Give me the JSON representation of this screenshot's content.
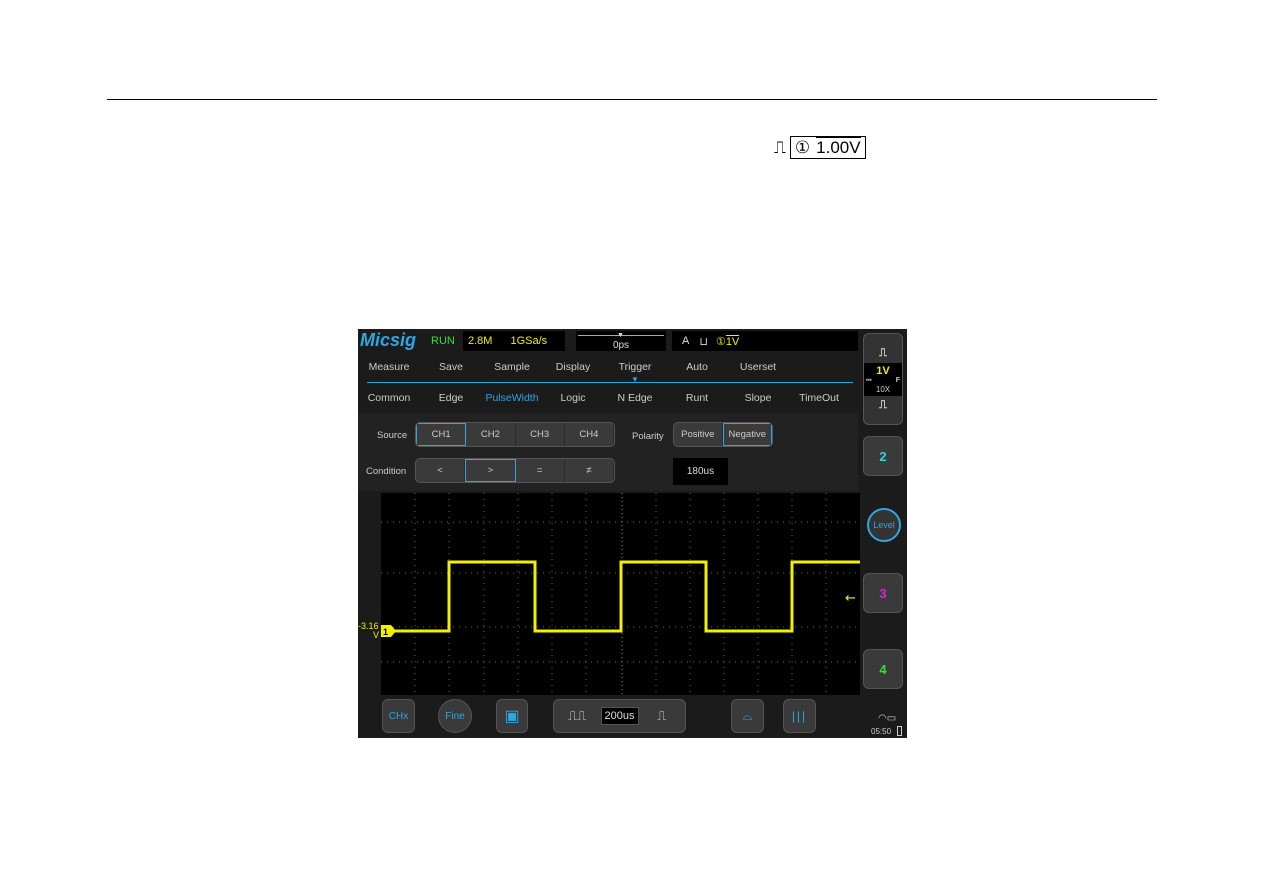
{
  "doc": {
    "trigger_symbol": "pulse-icon",
    "source": "①",
    "level": "1.00V"
  },
  "header": {
    "brand": "Micsig",
    "state": "RUN",
    "memory": "2.8M",
    "sample_rate": "1GSa/s",
    "time_offset": "0ps",
    "trigger_mode": "A",
    "trigger_source": "①",
    "trigger_level": "1V"
  },
  "menu": [
    "Measure",
    "Save",
    "Sample",
    "Display",
    "Trigger",
    "Auto",
    "Userset"
  ],
  "active_menu": "Trigger",
  "submenu": [
    "Common",
    "Edge",
    "PulseWidth",
    "Logic",
    "N Edge",
    "Runt",
    "Slope",
    "TimeOut"
  ],
  "active_submenu": "PulseWidth",
  "source": {
    "label": "Source",
    "options": [
      "CH1",
      "CH2",
      "CH3",
      "CH4"
    ],
    "selected": "CH1"
  },
  "polarity": {
    "label": "Polarity",
    "options": [
      "Positive",
      "Negative"
    ],
    "selected": "Negative"
  },
  "condition": {
    "label": "Condition",
    "options": [
      "<",
      ">",
      "=",
      "≠"
    ],
    "selected": ">"
  },
  "width_value": "180us",
  "channel1": {
    "offset_label": "-3.16",
    "offset_unit": "V",
    "marker": "1",
    "color": "#f0f000"
  },
  "right_panel": {
    "ch1_scale": "1V",
    "coupling": "⎓",
    "bw": "F",
    "probe": "10X",
    "ch2": "2",
    "ch3": "3",
    "ch4": "4",
    "level": "Level"
  },
  "bottom": {
    "chx": "CHx",
    "fine": "Fine",
    "timebase": "200us"
  },
  "status": {
    "time": "05:50"
  },
  "colors": {
    "accent": "#2fa6e0",
    "ch1": "#f0f000",
    "ch2": "#30d0e0",
    "ch3": "#e020e0",
    "ch4": "#30e030"
  }
}
